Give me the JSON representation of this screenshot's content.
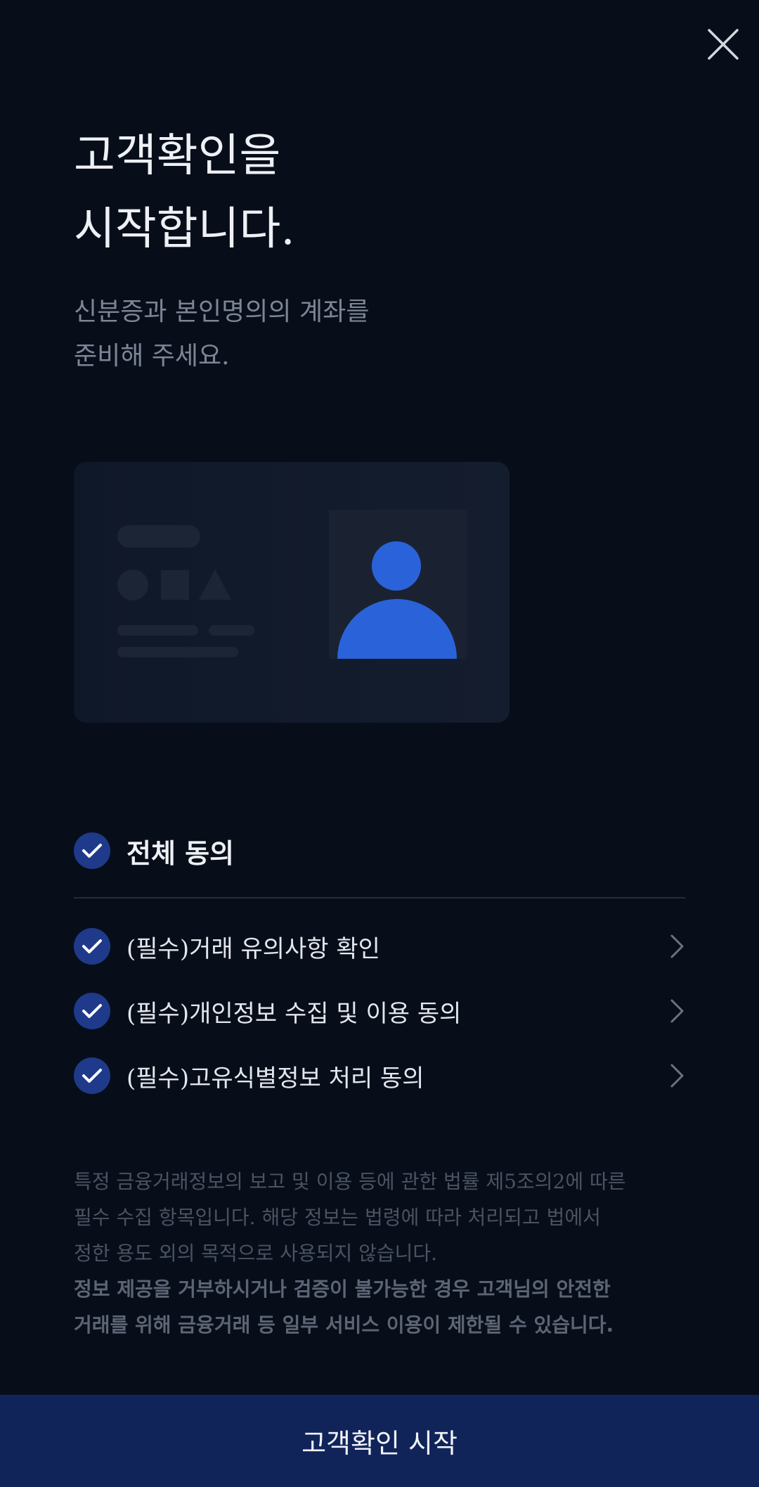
{
  "header": {
    "close_icon": "close-icon",
    "title_lines": [
      "고객확인을",
      "시작합니다."
    ],
    "subtitle_lines": [
      "신분증과 본인명의의 계좌를",
      "준비해 주세요."
    ]
  },
  "illustration": {
    "icon": "id-card-icon",
    "avatar_color": "#2a63d9"
  },
  "consent": {
    "agree_all": {
      "label": "전체 동의",
      "checked": true
    },
    "items": [
      {
        "label": "(필수)거래 유의사항 확인",
        "checked": true
      },
      {
        "label": "(필수)개인정보 수집 및 이용 동의",
        "checked": true
      },
      {
        "label": "(필수)고유식별정보 처리 동의",
        "checked": true
      }
    ]
  },
  "notice": {
    "lines": [
      "특정 금융거래정보의 보고 및 이용 등에 관한 법률 제5조의2에 따른",
      "필수 수집 항목입니다. 해당 정보는 법령에 따라 처리되고 법에서",
      "정한 용도 외의 목적으로 사용되지 않습니다."
    ],
    "strong_lines": [
      "정보 제공을 거부하시거나 검증이 불가능한 경우 고객님의 안전한",
      "거래를 위해 금융거래 등 일부 서비스 이용이 제한될 수 있습니다."
    ]
  },
  "cta": {
    "label": "고객확인 시작"
  },
  "colors": {
    "background": "#070e1a",
    "check_fill": "#1f3a8a",
    "cta_background": "#11245a",
    "accent_blue": "#2a63d9"
  }
}
